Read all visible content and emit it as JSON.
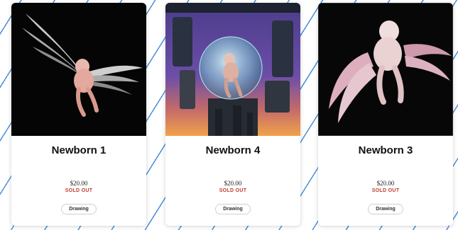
{
  "products": [
    {
      "title": "Newborn 1",
      "price": "$20.00",
      "status": "SOLD OUT",
      "tag": "Drawing",
      "art_icon": "winged-baby-on-black"
    },
    {
      "title": "Newborn 4",
      "price": "$20.00",
      "status": "SOLD OUT",
      "tag": "Drawing",
      "art_icon": "baby-in-glass-sphere-on-machine"
    },
    {
      "title": "Newborn 3",
      "price": "$20.00",
      "status": "SOLD OUT",
      "tag": "Drawing",
      "art_icon": "winged-baby-with-pink-wings"
    }
  ],
  "colors": {
    "background_stripe": "#4a90d9",
    "sold_out": "#c0392b",
    "card_bg": "#ffffff"
  }
}
